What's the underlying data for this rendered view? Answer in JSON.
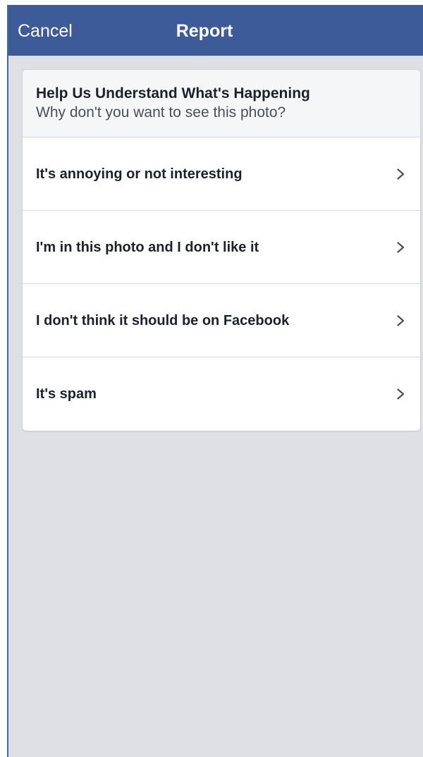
{
  "navbar": {
    "cancel_label": "Cancel",
    "title": "Report"
  },
  "card": {
    "title": "Help Us Understand What's Happening",
    "subtitle": "Why don't you want to see this photo?"
  },
  "options": [
    {
      "label": "It's annoying or not interesting",
      "icon": "chevron-right-icon"
    },
    {
      "label": "I'm in this photo and I don't like it",
      "icon": "chevron-right-icon"
    },
    {
      "label": "I don't think it should be on Facebook",
      "icon": "chevron-right-icon"
    },
    {
      "label": "It's spam",
      "icon": "chevron-right-icon"
    }
  ],
  "colors": {
    "navbar": "#3e5b99",
    "background": "#dfe0e4",
    "card": "#ffffff",
    "header_bg": "#f5f6f7"
  }
}
